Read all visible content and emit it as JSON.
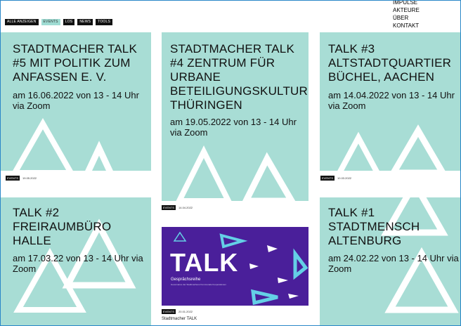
{
  "filters": [
    {
      "label": "ALLE ANZEIGEN",
      "active": false
    },
    {
      "label": "EVENTS",
      "active": true
    },
    {
      "label": "LOS",
      "active": false
    },
    {
      "label": "NEWS",
      "active": false
    },
    {
      "label": "TOOLS",
      "active": false
    }
  ],
  "menu": [
    "IMPULSE",
    "AKTEURE",
    "ÜBER",
    "KONTAKT"
  ],
  "cards": [
    {
      "title": "STADTMACHER TALK #5 MIT POLITIK ZUM ANFASSEN E. V.",
      "date_text": "am 16.06.2022 von 13 - 14 Uhr via Zoom",
      "tag": "EVENTS",
      "tag_date": "19.05.2022"
    },
    {
      "title": "STADTMACHER TALK #4 ZENTRUM FÜR URBANE BETEILIGUNGSKULTUR THÜRINGEN",
      "date_text": "am 19.05.2022 von 13 - 14 Uhr via Zoom",
      "tag": "EVENTS",
      "tag_date": "14.04.2022"
    },
    {
      "title": "TALK #3 ALTSTADTQUARTIER BÜCHEL, AACHEN",
      "date_text": "am 14.04.2022 von 13 - 14 Uhr via Zoom",
      "tag": "EVENTS",
      "tag_date": "10.03.2022"
    },
    {
      "title": "TALK #2 FREIRAUMBÜRO HALLE",
      "date_text": "am 17.03.22 von 13 - 14 Uhr via Zoom"
    },
    {
      "title": "TALK #1 STADTMENSCH ALTENBURG",
      "date_text": "am 24.02.22 von 13 - 14 Uhr via Zoom"
    }
  ],
  "talk_image": {
    "word": "TALK",
    "subtitle": "Gesprächsreihe",
    "small": "Governance der Stadtmacherei Kommunale Kooperationen",
    "tag": "EVENTS",
    "tag_date": "20.01.2022",
    "caption": "Stadtmacher TALK"
  },
  "colors": {
    "card": "#a8ddd5",
    "talk_bg": "#4a1f9a",
    "tri_white": "#ffffff",
    "tri_cyan": "#64d0e6"
  }
}
